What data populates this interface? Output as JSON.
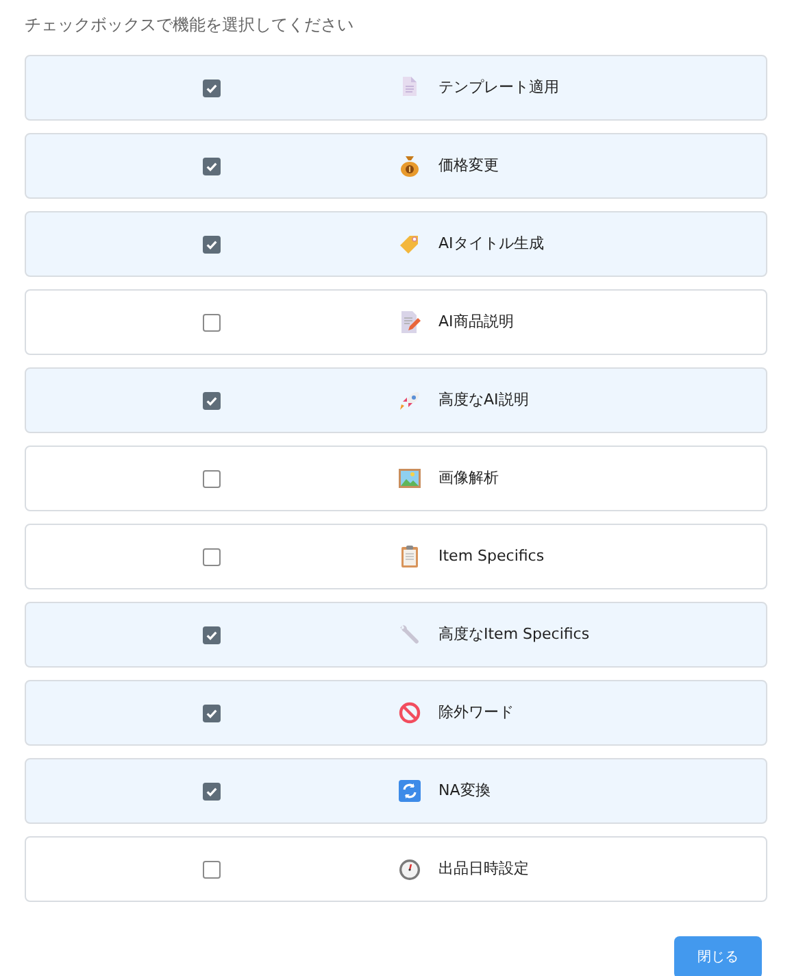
{
  "instruction": "チェックボックスで機能を選択してください",
  "features": [
    {
      "label": "テンプレート適用",
      "checked": true
    },
    {
      "label": "価格変更",
      "checked": true
    },
    {
      "label": "AIタイトル生成",
      "checked": true
    },
    {
      "label": "AI商品説明",
      "checked": false
    },
    {
      "label": "高度なAI説明",
      "checked": true
    },
    {
      "label": "画像解析",
      "checked": false
    },
    {
      "label": "Item Specifics",
      "checked": false
    },
    {
      "label": "高度なItem Specifics",
      "checked": true
    },
    {
      "label": "除外ワード",
      "checked": true
    },
    {
      "label": "NA変換",
      "checked": true
    },
    {
      "label": "出品日時設定",
      "checked": false
    }
  ],
  "close_button": "閉じる"
}
